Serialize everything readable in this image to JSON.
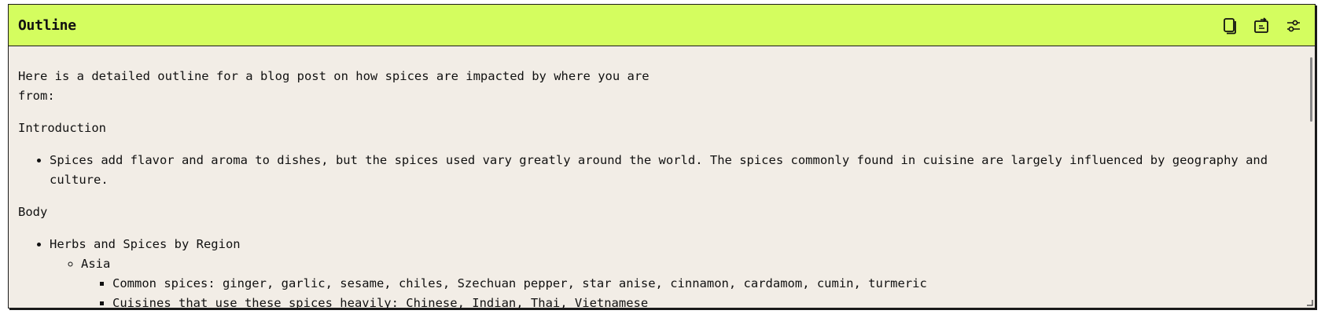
{
  "header": {
    "title": "Outline",
    "accent_color": "#d4fd5f",
    "actions": [
      {
        "name": "copy-icon"
      },
      {
        "name": "export-icon"
      },
      {
        "name": "settings-sliders-icon"
      }
    ]
  },
  "content": {
    "intro": "Here is a detailed outline for a blog post on how spices are impacted by where you are from:",
    "introduction_heading": "Introduction",
    "introduction_bullet": "Spices add flavor and aroma to dishes, but the spices used vary greatly around the world. The spices commonly found in cuisine are largely influenced by geography and culture.",
    "body_heading": "Body",
    "body_bullet": "Herbs and Spices by Region",
    "region": "Asia",
    "region_items": [
      "Common spices: ginger, garlic, sesame, chiles, Szechuan pepper, star anise, cinnamon, cardamom, cumin, turmeric",
      "Cuisines that use these spices heavily: Chinese, Indian, Thai, Vietnamese"
    ]
  }
}
